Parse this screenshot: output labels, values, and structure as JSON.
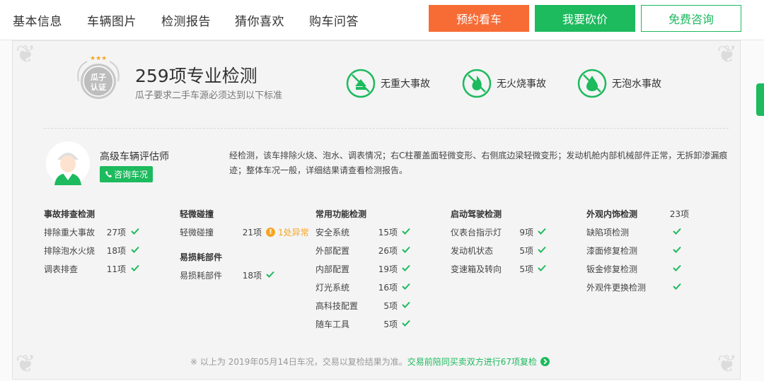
{
  "nav": {
    "tabs": [
      "基本信息",
      "车辆图片",
      "检测报告",
      "猜你喜欢",
      "购车问答"
    ],
    "book_button": "预约看车",
    "bargain_button": "我要砍价",
    "consult_button": "免费咨询"
  },
  "header": {
    "badge_line1": "瓜子",
    "badge_line2": "认证",
    "title": "259项专业检测",
    "subtitle": "瓜子要求二手车源必须达到以下标准",
    "features": [
      "无重大事故",
      "无火烧事故",
      "无泡水事故"
    ]
  },
  "assessor": {
    "title": "高级车辆评估师",
    "consult_label": "咨询车况",
    "summary": "经检测，该车排除火烧、泡水、调表情况；右C柱覆盖面轻微变形、右侧底边梁轻微变形；发动机舱内部机械部件正常，无拆卸渗漏痕迹；整体车况一般，详细结果请查看检测报告。"
  },
  "groups": [
    {
      "title": "事故排查检测",
      "items": [
        {
          "name": "排除重大事故",
          "count": "27项"
        },
        {
          "name": "排除泡水火烧",
          "count": "18项"
        },
        {
          "name": "调表排查",
          "count": "11项"
        }
      ]
    },
    {
      "title": "轻微碰撞",
      "items": [
        {
          "name": "轻微碰撞",
          "count": "21项",
          "warning": "1处异常"
        }
      ]
    },
    {
      "title": "易损耗部件",
      "items": [
        {
          "name": "易损耗部件",
          "count": "18项"
        }
      ]
    },
    {
      "title": "常用功能检测",
      "items": [
        {
          "name": "安全系统",
          "count": "15项"
        },
        {
          "name": "外部配置",
          "count": "26项"
        },
        {
          "name": "内部配置",
          "count": "19项"
        },
        {
          "name": "灯光系统",
          "count": "16项"
        },
        {
          "name": "高科技配置",
          "count": "5项"
        },
        {
          "name": "随车工具",
          "count": "5项"
        }
      ]
    },
    {
      "title": "启动驾驶检测",
      "items": [
        {
          "name": "仪表台指示灯",
          "count": "9项"
        },
        {
          "name": "发动机状态",
          "count": "5项"
        },
        {
          "name": "变速箱及转向",
          "count": "5项"
        }
      ]
    },
    {
      "title": "外观内饰检测",
      "title_count": "23项",
      "items": [
        {
          "name": "缺陷项检测"
        },
        {
          "name": "漆面修复检测"
        },
        {
          "name": "钣金修复检测"
        },
        {
          "name": "外观件更换检测"
        }
      ]
    }
  ],
  "footer": {
    "note": "※  以上为 2019年05月14日车况，交易以复检结果为准。",
    "highlight": "交易前陪同买卖双方进行67项复检"
  },
  "colors": {
    "green": "#1dba5e",
    "orange": "#f76b35",
    "warning": "#f5a623"
  }
}
